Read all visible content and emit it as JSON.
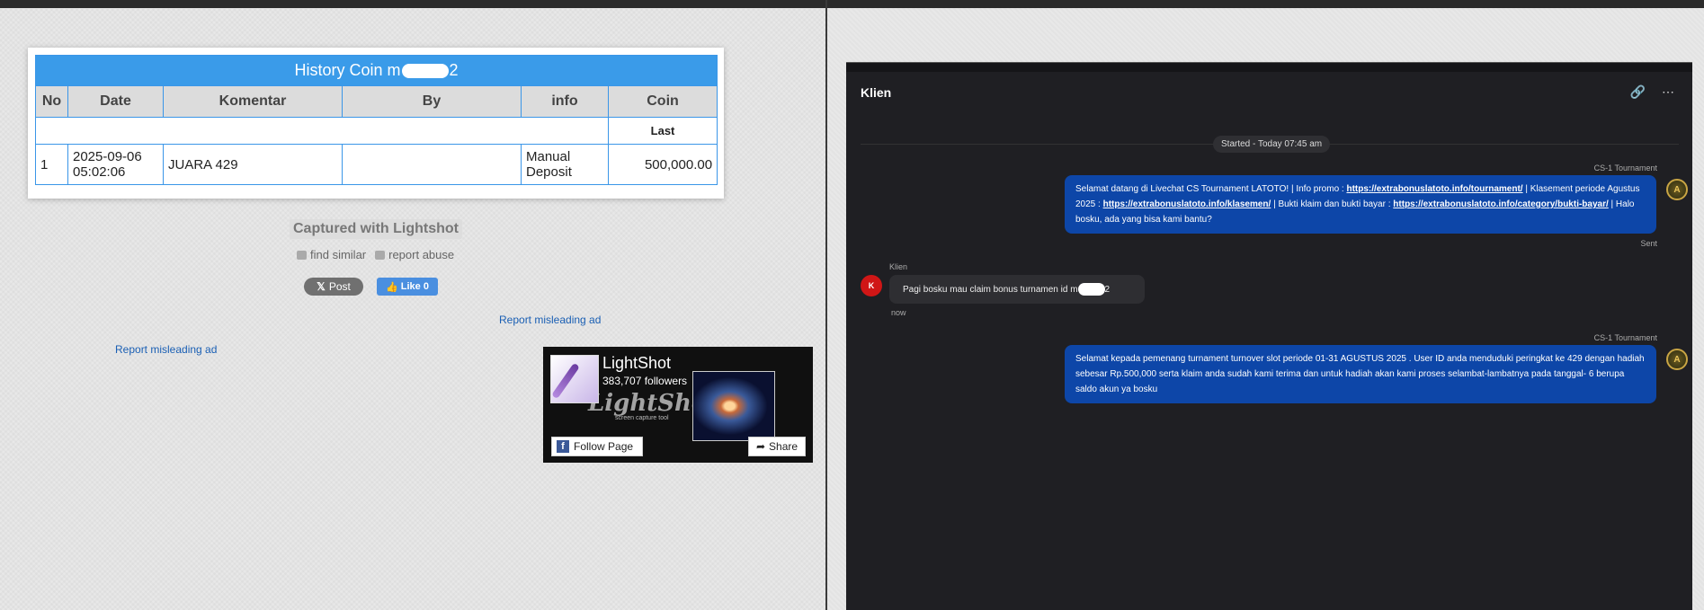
{
  "table": {
    "title_prefix": "History Coin m",
    "title_suffix": "2",
    "headers": [
      "No",
      "Date",
      "Komentar",
      "By",
      "info",
      "Coin"
    ],
    "last_label": "Last",
    "row": {
      "no": "1",
      "date_line1": "2025-09-06",
      "date_line2": "05:02:06",
      "komentar": "JUARA 429",
      "by": "",
      "info_line1": "Manual",
      "info_line2": "Deposit",
      "coin": "500,000.00"
    }
  },
  "lightshot": {
    "captured": "Captured with Lightshot",
    "find_similar": "find similar",
    "report_abuse": "report abuse",
    "post": "Post",
    "like": "Like 0",
    "report_misleading_1": "Report misleading ad",
    "report_misleading_2": "Report misleading ad"
  },
  "fb_widget": {
    "name": "LightShot",
    "followers": "383,707 followers",
    "logo_text": "LightShot",
    "logo_sub": "screen capture tool",
    "follow": "Follow Page",
    "share": "Share"
  },
  "chat": {
    "title": "Klien",
    "started": "Started - Today 07:45 am",
    "agent_name_1": "CS-1 Tournament",
    "msg1": {
      "p1": "Selamat datang di Livechat CS Tournament LATOTO! | Info promo : ",
      "l1": "https://extrabonuslatoto.info/tournament/",
      "p2": " | Klasement periode Agustus 2025 : ",
      "l2": "https://extrabonuslatoto.info/klasemen/",
      "p3": " | Bukti klaim dan bukti bayar : ",
      "l3": "https://extrabonuslatoto.info/category/bukti-bayar/",
      "p4": " | Halo bosku, ada yang bisa kami bantu?"
    },
    "sent": "Sent",
    "client_name": "Klien",
    "client_initial": "K",
    "client_msg_prefix": "Pagi bosku mau claim bonus turnamen id m",
    "client_msg_suffix": "2",
    "now": "now",
    "agent_name_2": "CS-1 Tournament",
    "msg2": "Selamat kepada pemenang turnament turnover slot periode 01-31 AGUSTUS 2025 . User ID anda menduduki peringkat ke 429 dengan hadiah sebesar Rp.500,000 serta klaim anda sudah kami terima dan untuk hadiah akan kami proses selambat-lambatnya pada tanggal- 6 berupa saldo akun ya bosku",
    "agent_initial": "A"
  }
}
